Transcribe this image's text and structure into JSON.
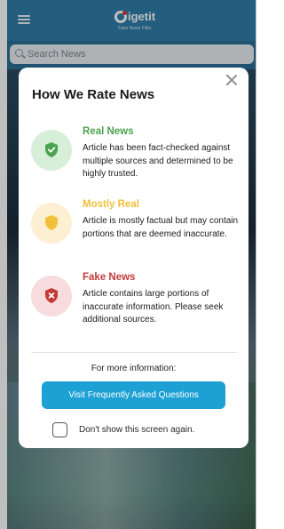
{
  "app": {
    "logo_text": "igetit",
    "logo_tagline": "Fake News Filter"
  },
  "search": {
    "placeholder": "Search News",
    "value": ""
  },
  "modal": {
    "title": "How We Rate News",
    "ratings": [
      {
        "name": "Real News",
        "description": "Article has been fact-checked against multiple sources and determined to be highly trusted.",
        "icon": "check-shield-icon",
        "color": "#4aa34e",
        "badge_bg": "#d7efd9"
      },
      {
        "name": "Mostly Real",
        "description": "Article is mostly factual but may contain portions that are deemed inaccurate.",
        "icon": "shield-icon",
        "color": "#f2c13a",
        "badge_bg": "#fdf0d2"
      },
      {
        "name": "Fake News",
        "description": "Article contains large portions of inaccurate information. Please seek additional sources.",
        "icon": "x-shield-icon",
        "color": "#c23a3a",
        "badge_bg": "#f7dbdd"
      }
    ],
    "more_info": "For more information:",
    "faq_button": "Visit Frequently Asked Questions",
    "checkbox_label": "Don't show this screen again.",
    "checkbox_checked": false
  },
  "colors": {
    "accent": "#1da1d4",
    "header": "#2f7ea8"
  }
}
